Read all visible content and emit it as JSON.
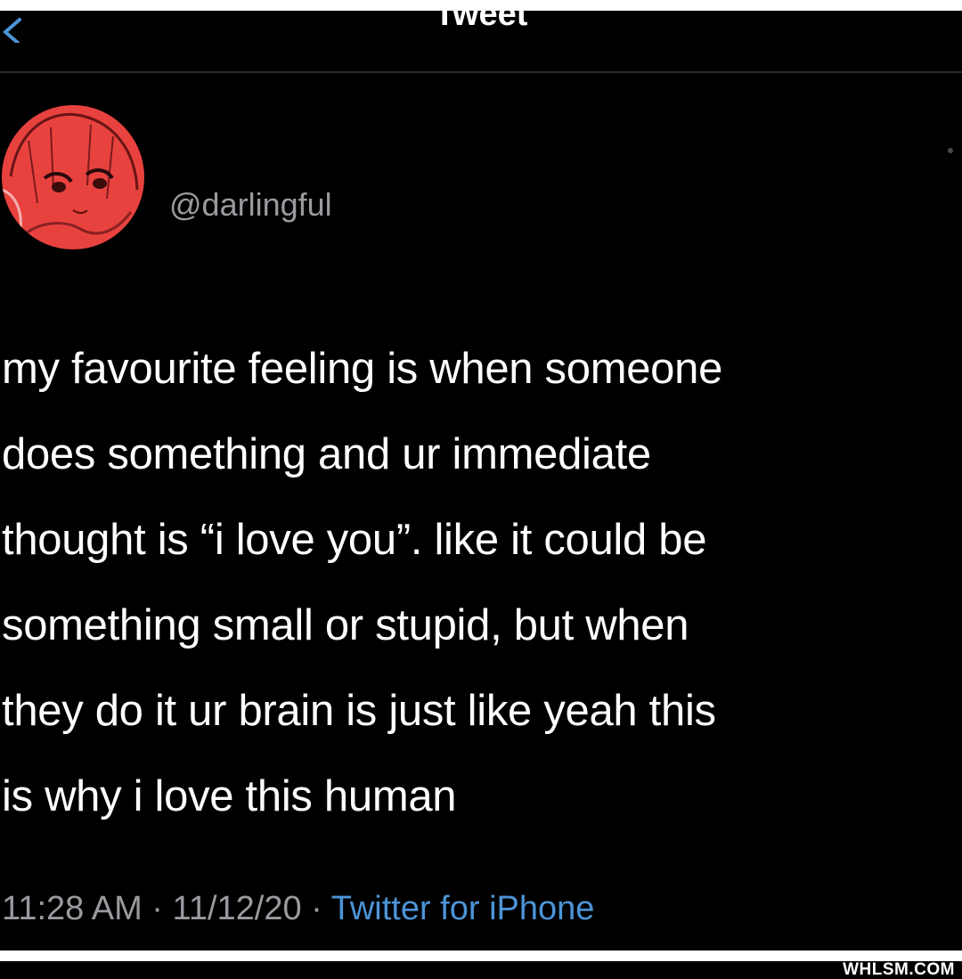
{
  "header": {
    "title": "Tweet",
    "back_icon": "chevron-left-icon"
  },
  "author": {
    "handle": "@darlingful",
    "avatar": "anime-girl-avatar",
    "avatar_color": "#e8423f"
  },
  "tweet": {
    "lines": [
      "my favourite feeling is when someone",
      "does something and ur immediate",
      "thought is “i love you”. like it could be",
      "something small or stupid, but when",
      "they do it ur brain is just like yeah this",
      "is why i love this human"
    ]
  },
  "meta": {
    "time": "11:28 AM",
    "separator": " · ",
    "date": "11/12/20",
    "source": "Twitter for iPhone",
    "source_color": "#4c94d6"
  },
  "watermark": {
    "text": "WHLSM.COM"
  }
}
